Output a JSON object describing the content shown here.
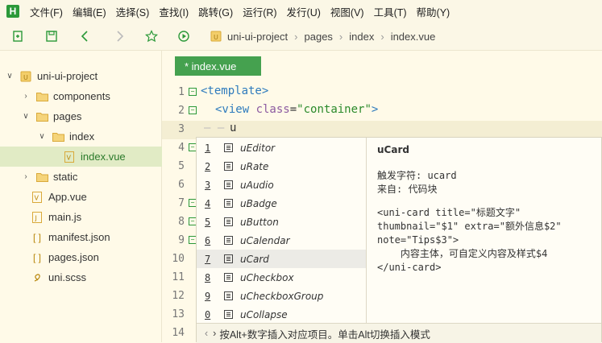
{
  "menubar": {
    "logo": "H",
    "items": [
      "文件(F)",
      "编辑(E)",
      "选择(S)",
      "查找(I)",
      "跳转(G)",
      "运行(R)",
      "发行(U)",
      "视图(V)",
      "工具(T)",
      "帮助(Y)"
    ]
  },
  "toolbar": {
    "breadcrumb": [
      "uni-ui-project",
      "pages",
      "index",
      "index.vue"
    ]
  },
  "sidebar": {
    "items": [
      {
        "label": "uni-ui-project"
      },
      {
        "label": "components"
      },
      {
        "label": "pages"
      },
      {
        "label": "index"
      },
      {
        "label": "index.vue"
      },
      {
        "label": "static"
      },
      {
        "label": "App.vue"
      },
      {
        "label": "main.js"
      },
      {
        "label": "manifest.json"
      },
      {
        "label": "pages.json"
      },
      {
        "label": "uni.scss"
      }
    ]
  },
  "editor": {
    "tab_label": "* index.vue",
    "line_numbers": [
      "1",
      "2",
      "3",
      "4",
      "5",
      "6",
      "7",
      "8",
      "9",
      "10",
      "11",
      "12",
      "13",
      "14"
    ],
    "line1": {
      "tag": "<template>"
    },
    "line2": {
      "open": "<view ",
      "attr": "class",
      "eq": "=",
      "value": "\"container\"",
      "close": ">"
    },
    "line3": {
      "typed": "u"
    }
  },
  "autocomplete": {
    "suggestions": [
      {
        "num": "1",
        "label": "uEditor"
      },
      {
        "num": "2",
        "label": "uRate"
      },
      {
        "num": "3",
        "label": "uAudio"
      },
      {
        "num": "4",
        "label": "uBadge"
      },
      {
        "num": "5",
        "label": "uButton"
      },
      {
        "num": "6",
        "label": "uCalendar"
      },
      {
        "num": "7",
        "label": "uCard"
      },
      {
        "num": "8",
        "label": "uCheckbox"
      },
      {
        "num": "9",
        "label": "uCheckboxGroup"
      },
      {
        "num": "0",
        "label": "uCollapse"
      }
    ],
    "detail": {
      "title": "uCard",
      "trigger": "触发字符: ucard",
      "source": "来自: 代码块",
      "snippet": [
        "<uni-card title=\"标题文字\"",
        "thumbnail=\"$1\" extra=\"额外信息$2\"",
        "note=\"Tips$3\">",
        "    内容主体，可自定义内容及样式$4",
        "</uni-card>"
      ]
    },
    "footer_text": "按Alt+数字插入对应项目。单击Alt切换插入模式"
  },
  "colors": {
    "accent": "#45a14f",
    "selected_bg": "#e1ebc5",
    "background": "#fffae8"
  }
}
